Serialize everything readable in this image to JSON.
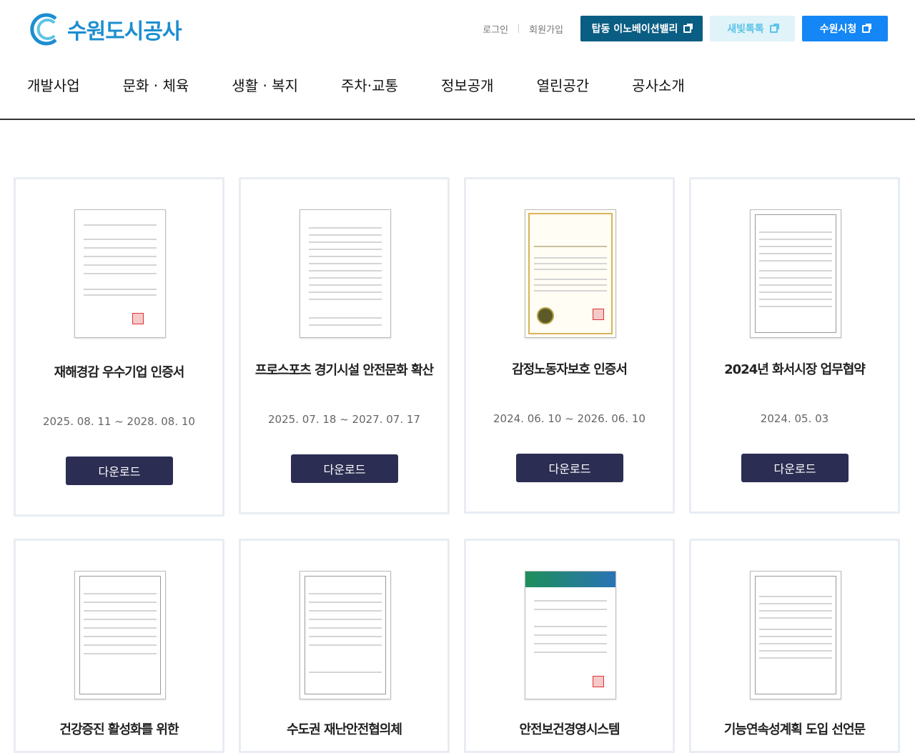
{
  "header": {
    "logo_text": "수원도시공사",
    "util_links": [
      "로그인",
      "회원가입"
    ],
    "ext_buttons": [
      "탑동 이노베이션밸리",
      "새빛톡톡",
      "수원시청"
    ],
    "nav": [
      "개발사업",
      "문화 · 체육",
      "생활 · 복지",
      "주차·교통",
      "정보공개",
      "열린공간",
      "공사소개"
    ]
  },
  "cards": [
    {
      "title": "재해경감 우수기업 인증서",
      "date": "2025. 08. 11 ~ 2028. 08. 10",
      "button": "다운로드"
    },
    {
      "title": "프로스포츠 경기시설 안전문화 확산",
      "date": "2025. 07. 18 ~ 2027. 07. 17",
      "button": "다운로드"
    },
    {
      "title": "감정노동자보호 인증서",
      "date": "2024. 06. 10 ~ 2026. 06. 10",
      "button": "다운로드"
    },
    {
      "title": "2024년 화서시장 업무협약",
      "date": "2024. 05. 03",
      "button": "다운로드"
    },
    {
      "title": "건강증진 활성화를 위한",
      "date": "",
      "button": ""
    },
    {
      "title": "수도권 재난안전협의체",
      "date": "",
      "button": ""
    },
    {
      "title": "안전보건경영시스템",
      "date": "",
      "button": ""
    },
    {
      "title": "기능연속성계획 도입 선언문",
      "date": "",
      "button": ""
    }
  ]
}
